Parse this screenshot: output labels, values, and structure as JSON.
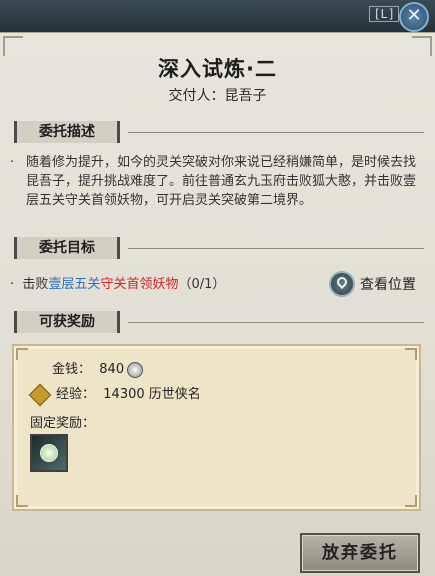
{
  "window": {
    "hotkey": "[L]",
    "close_icon": "close-x-icon"
  },
  "quest": {
    "title": "深入试炼·二",
    "giver_label": "交付人：昆吾子"
  },
  "sections": {
    "description_title": "委托描述",
    "description_text": "随着修为提升，如今的灵关突破对你来说已经稍嫌简单，是时候去找昆吾子，提升挑战难度了。前往普通玄九玉府击败狐大憨，并击败壹层五关守关首领妖物，可开启灵关突破第二境界。",
    "objective_title": "委托目标",
    "objective_prefix": "击败",
    "objective_location": "壹层五关",
    "objective_target": "守关首领妖物",
    "objective_progress": "（0/1）",
    "view_location_label": "查看位置",
    "reward_title": "可获奖励"
  },
  "rewards": {
    "money_label": "金钱：",
    "money_value": "840",
    "exp_label": "经验：",
    "exp_value": "14300 历世侠名",
    "fixed_label": "固定奖励："
  },
  "buttons": {
    "abandon_label": "放弃委托"
  },
  "colors": {
    "location_blue": "#2c6fc4",
    "target_red": "#d32222"
  }
}
